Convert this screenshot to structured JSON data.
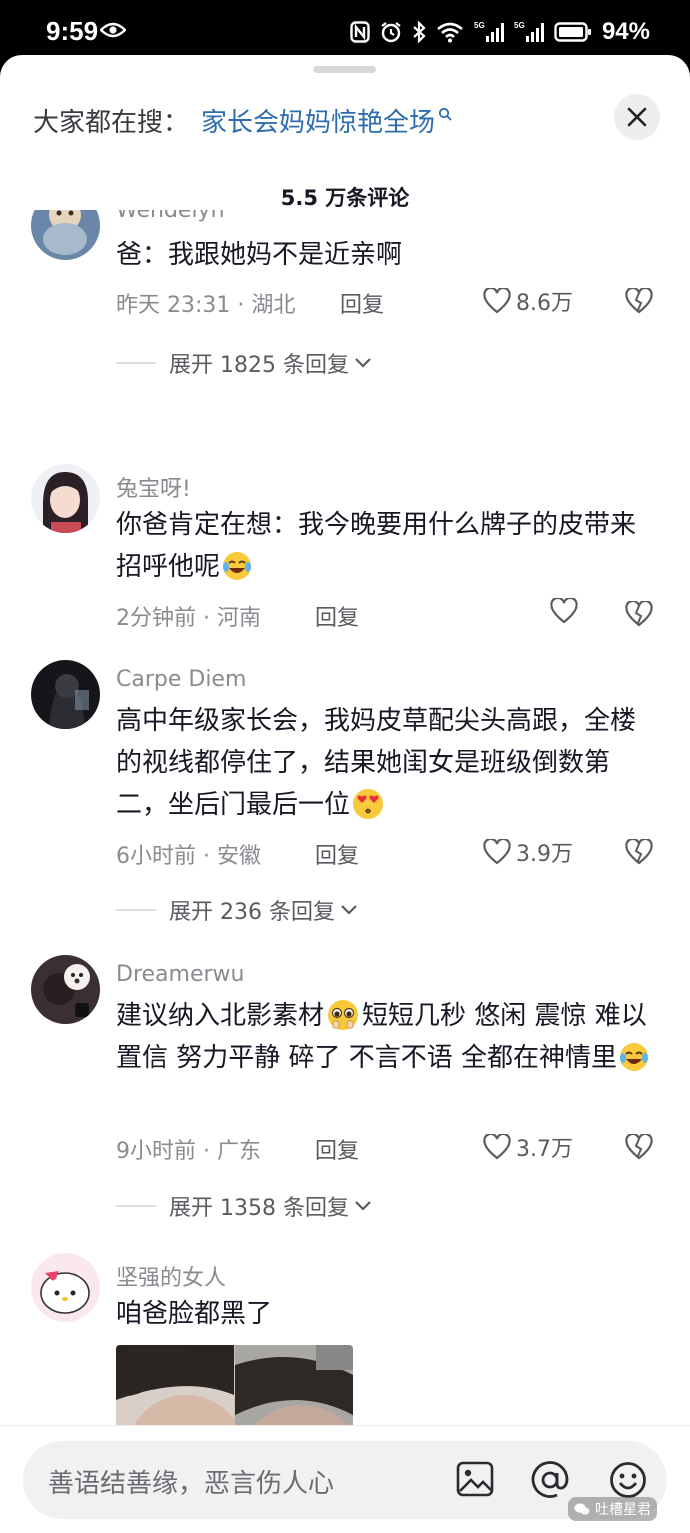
{
  "status_bar": {
    "time": "9:59",
    "battery": "94%"
  },
  "search_suggestion": {
    "prefix": "大家都在搜：",
    "term": "家长会妈妈惊艳全场"
  },
  "comment_count": "5.5 万条评论",
  "comments": [
    {
      "username": "Wendelyn",
      "text": "爸：我跟她妈不是近亲啊",
      "time": "昨天 23:31 · 湖北",
      "reply": "回复",
      "likes": "8.6万",
      "expand": "展开 1825 条回复"
    },
    {
      "username": "兔宝呀!",
      "text": "你爸肯定在想：我今晚要用什么牌子的皮带来招呼他呢",
      "time": "2分钟前 · 河南",
      "reply": "回复",
      "likes": "",
      "expand": ""
    },
    {
      "username": "Carpe Diem",
      "text": "高中年级家长会，我妈皮草配尖头高跟，全楼的视线都停住了，结果她闺女是班级倒数第二，坐后门最后一位",
      "time": "6小时前 · 安徽",
      "reply": "回复",
      "likes": "3.9万",
      "expand": "展开 236 条回复"
    },
    {
      "username": "Dreamerwu",
      "text_part1": "建议纳入北影素材",
      "text_part2": "短短几秒 悠闲 震惊 难以置信 努力平静 碎了 不言不语 全都在神情里",
      "time": "9小时前 · 广东",
      "reply": "回复",
      "likes": "3.7万",
      "expand": "展开 1358 条回复"
    },
    {
      "username": "坚强的女人",
      "text": "咱爸脸都黑了"
    }
  ],
  "input": {
    "placeholder": "善语结善缘，恶言伤人心"
  },
  "watermark": "吐槽星君",
  "colors": {
    "link": "#2e6dad",
    "muted": "#8a8b91",
    "text": "#161823"
  }
}
